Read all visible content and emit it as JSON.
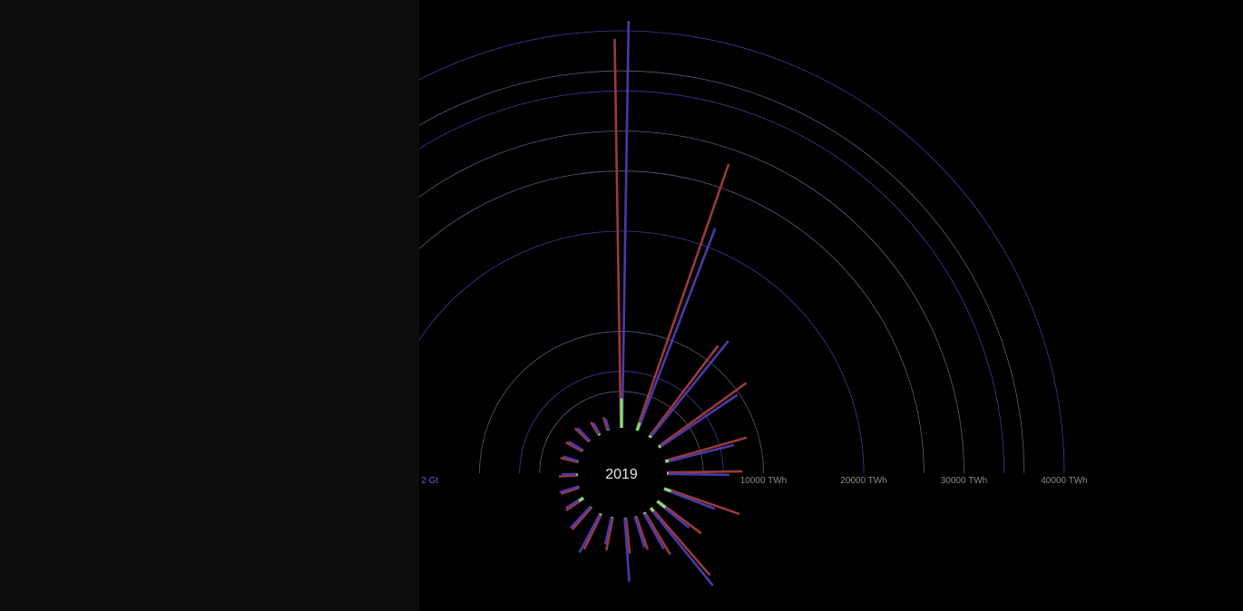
{
  "colors": {
    "background": "#000000",
    "panel": "#0d0d0d",
    "ring_twh": "#5a5a7a",
    "ring_gt": "#3e3a9a",
    "label_twh": "#8a8a8a",
    "label_gt": "#6b5fd0",
    "series_a": "#9a3a3a",
    "series_b": "#4a3aa8",
    "series_c": "#7ee36a",
    "year": "#e6e6e6"
  },
  "chart_data": {
    "type": "radial-bar",
    "year": "2019",
    "twh_axis": {
      "unit": "TWh",
      "tick_values": [
        10000,
        20000,
        30000,
        40000
      ],
      "tick_labels": [
        "10000 TWh",
        "20000 TWh",
        "30000 TWh",
        "40000 TWh"
      ],
      "max": 40000,
      "extra_rings": [
        4000,
        6000,
        26000,
        34000,
        36000
      ]
    },
    "gt_axis": {
      "unit": "Gt",
      "tick_values": [
        2,
        4
      ],
      "tick_labels": [
        "2 Gt",
        "Gt"
      ],
      "max": 4
    },
    "bars": [
      {
        "angle": 0,
        "a": 39200,
        "b": 41000,
        "c": 3300
      },
      {
        "angle": 20,
        "a": 28500,
        "b": 22000,
        "c": 1200
      },
      {
        "angle": 38,
        "a": 11800,
        "b": 12800,
        "c": 600
      },
      {
        "angle": 55,
        "a": 11200,
        "b": 9800,
        "c": 600
      },
      {
        "angle": 75,
        "a": 8800,
        "b": 7400,
        "c": 700
      },
      {
        "angle": 90,
        "a": 7900,
        "b": 6600,
        "c": 500
      },
      {
        "angle": 110,
        "a": 8300,
        "b": 5800,
        "c": 1100
      },
      {
        "angle": 128,
        "a": 5800,
        "b": 4500,
        "c": 1400
      },
      {
        "angle": 140,
        "a": 9300,
        "b": 10300,
        "c": 800
      },
      {
        "angle": 150,
        "a": 5300,
        "b": 4500,
        "c": 500
      },
      {
        "angle": 162,
        "a": 3900,
        "b": 3600,
        "c": 400
      },
      {
        "angle": 175,
        "a": 3900,
        "b": 6700,
        "c": 300
      },
      {
        "angle": 192,
        "a": 3700,
        "b": 3100,
        "c": 300
      },
      {
        "angle": 207,
        "a": 4300,
        "b": 4800,
        "c": 500
      },
      {
        "angle": 222,
        "a": 3300,
        "b": 3300,
        "c": 400
      },
      {
        "angle": 237,
        "a": 2500,
        "b": 2400,
        "c": 900
      },
      {
        "angle": 252,
        "a": 2200,
        "b": 2300,
        "c": 300
      },
      {
        "angle": 268,
        "a": 2100,
        "b": 1800,
        "c": 200
      },
      {
        "angle": 285,
        "a": 2100,
        "b": 1900,
        "c": 300
      },
      {
        "angle": 300,
        "a": 2200,
        "b": 2000,
        "c": 300
      },
      {
        "angle": 315,
        "a": 2300,
        "b": 2100,
        "c": 400
      },
      {
        "angle": 330,
        "a": 1800,
        "b": 1600,
        "c": 200
      },
      {
        "angle": 343,
        "a": 1700,
        "b": 1500,
        "c": 300
      }
    ]
  }
}
